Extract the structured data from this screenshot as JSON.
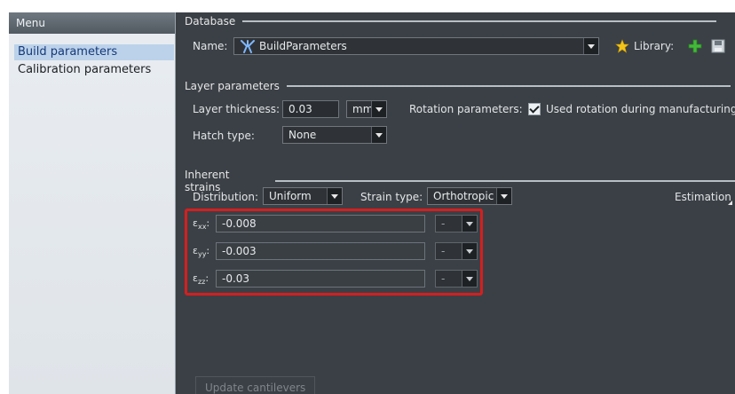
{
  "menu": {
    "title": "Menu",
    "items": [
      {
        "label": "Build parameters",
        "selected": true
      },
      {
        "label": "Calibration parameters",
        "selected": false
      }
    ]
  },
  "database": {
    "group_title": "Database",
    "name_label": "Name:",
    "name_value": "BuildParameters",
    "library_label": "Library:"
  },
  "layer": {
    "group_title": "Layer parameters",
    "thickness_label": "Layer thickness:",
    "thickness_value": "0.03",
    "thickness_unit": "mm",
    "rotation_label": "Rotation parameters:",
    "rotation_check_label": "Used rotation during manufacturing",
    "rotation_checked": true,
    "hatch_label": "Hatch type:",
    "hatch_value": "None"
  },
  "strains": {
    "group_title": "Inherent strains",
    "distribution_label": "Distribution:",
    "distribution_value": "Uniform",
    "strain_type_label": "Strain type:",
    "strain_type_value": "Orthotropic",
    "estimation_label": "Estimation",
    "rows": [
      {
        "symbol": "ε",
        "sub": "xx",
        "value": "-0.008",
        "unit": "-"
      },
      {
        "symbol": "ε",
        "sub": "yy",
        "value": "-0.003",
        "unit": "-"
      },
      {
        "symbol": "ε",
        "sub": "zz",
        "value": "-0.03",
        "unit": "-"
      }
    ]
  },
  "footer": {
    "update_button": "Update cantilevers"
  },
  "colors": {
    "highlight_border": "#d41f1f",
    "panel_bg": "#3b4046",
    "menu_selected": "#bcd2ea"
  }
}
